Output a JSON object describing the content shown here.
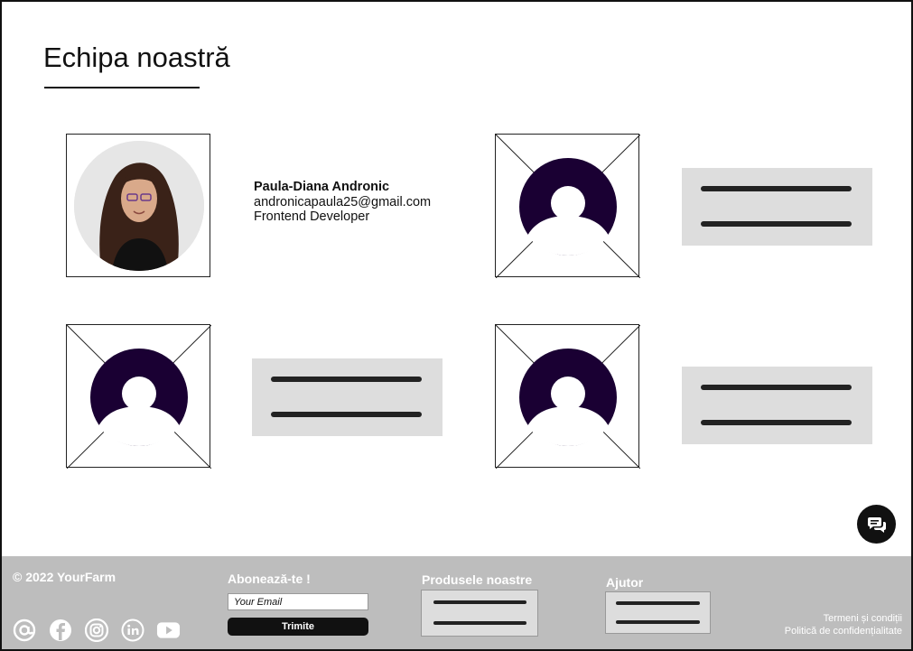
{
  "page": {
    "title": "Echipa noastră"
  },
  "member": {
    "name": "Paula-Diana Andronic",
    "email": "andronicapaula25@gmail.com",
    "role": "Frontend Developer",
    "photo_icon": "portrait-photo"
  },
  "placeholders": {
    "avatar_icon": "user-avatar-icon",
    "count": 3
  },
  "chat": {
    "icon": "chat-bubbles-icon"
  },
  "footer": {
    "copyright": "© 2022 YourFarm",
    "subscribe": {
      "title": "Abonează-te !",
      "email_placeholder": "Your Email",
      "submit_label": "Trimite"
    },
    "products_title": "Produsele noastre",
    "help_title": "Ajutor",
    "terms": "Termeni și condiții",
    "privacy": "Politică de confidențialitate",
    "socials": [
      "email-at-icon",
      "facebook-icon",
      "instagram-icon",
      "linkedin-icon",
      "youtube-icon"
    ]
  },
  "colors": {
    "accent": "#1a0033",
    "footer_bg": "#bdbdbd",
    "placeholder_bg": "#dddddd"
  }
}
